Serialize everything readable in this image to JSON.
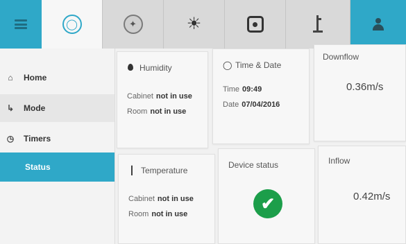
{
  "sidebar": {
    "items": [
      {
        "label": "Home",
        "icon": "home-icon"
      },
      {
        "label": "Mode",
        "icon": "mode-icon"
      },
      {
        "label": "Timers",
        "icon": "clock-icon"
      },
      {
        "label": "Status",
        "icon": ""
      }
    ]
  },
  "toolbar": {
    "icons": [
      "menu-icon",
      "bulb-icon",
      "fan-icon",
      "sun-icon",
      "socket-icon",
      "ladder-icon",
      "person-icon"
    ]
  },
  "humidity": {
    "title": "Humidity",
    "cabinet_label": "Cabinet",
    "cabinet_value": "not in use",
    "room_label": "Room",
    "room_value": "not in use"
  },
  "timedate": {
    "title": "Time & Date",
    "time_label": "Time",
    "time_value": "09:49",
    "date_label": "Date",
    "date_value": "07/04/2016"
  },
  "downflow": {
    "title": "Downflow",
    "value": "0.36m/s"
  },
  "temperature": {
    "title": "Temperature",
    "cabinet_label": "Cabinet",
    "cabinet_value": "not in use",
    "room_label": "Room",
    "room_value": "not in use"
  },
  "device": {
    "title": "Device status",
    "status": "ok"
  },
  "inflow": {
    "title": "Inflow",
    "value": "0.42m/s"
  },
  "colors": {
    "accent": "#2fa8c8",
    "ok": "#1c9e4a"
  }
}
